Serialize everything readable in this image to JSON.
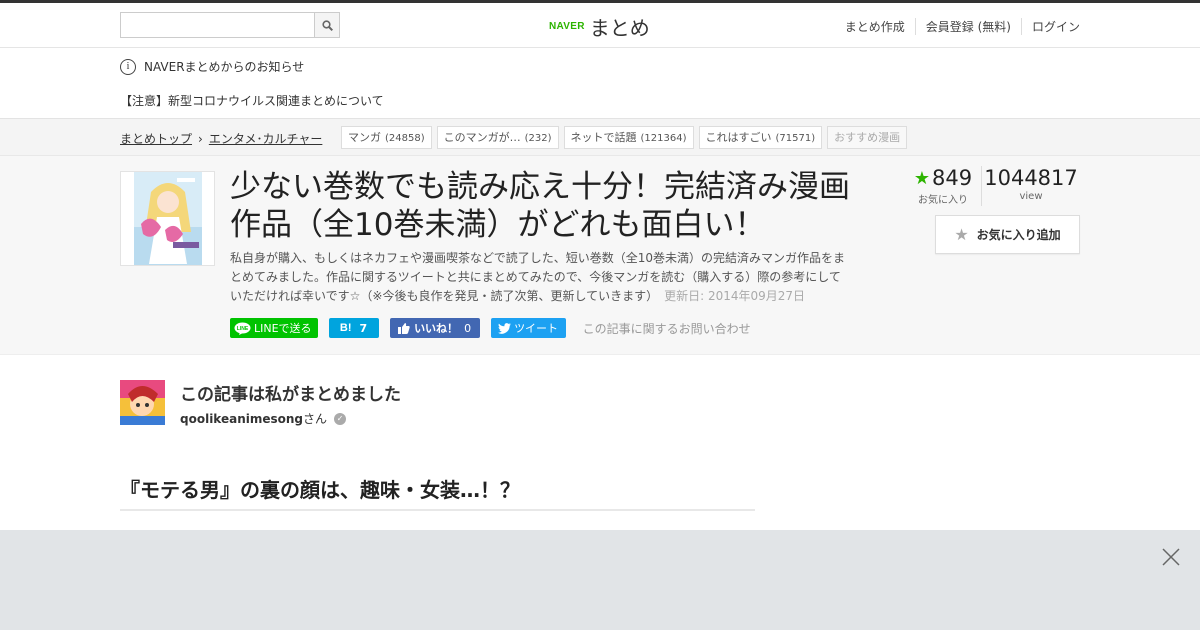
{
  "header": {
    "search_placeholder": "",
    "logo_brand": "NAVER",
    "logo_text": "まとめ",
    "nav": [
      "まとめ作成",
      "会員登録 (無料)",
      "ログイン"
    ]
  },
  "notice": {
    "title": "NAVERまとめからのお知らせ",
    "message": "【注意】新型コロナウイルス関連まとめについて"
  },
  "breadcrumb": {
    "home": "まとめトップ",
    "category": "エンタメ･カルチャー"
  },
  "tags": [
    {
      "label": "マンガ",
      "count": "(24858)"
    },
    {
      "label": "このマンガが…",
      "count": "(232)"
    },
    {
      "label": "ネットで話題",
      "count": "(121364)"
    },
    {
      "label": "これはすごい",
      "count": "(71571)"
    },
    {
      "label": "おすすめ漫画",
      "count": ""
    }
  ],
  "article": {
    "title": "少ない巻数でも読み応え十分！完結済み漫画作品（全10巻未満）がどれも面白い！",
    "description": "私自身が購入、もしくはネカフェや漫画喫茶などで読了した、短い巻数（全10巻未満）の完結済みマンガ作品をまとめてみました。作品に関するツイートと共にまとめてみたので、今後マンガを読む（購入する）際の参考にしていただければ幸いです☆（※今後も良作を発見・読了次第、更新していきます）",
    "updated": "更新日: 2014年09月27日",
    "favorites": "849",
    "favorites_label": "お気に入り",
    "views": "1044817",
    "views_label": "view",
    "fav_button": "お気に入り追加"
  },
  "share": {
    "line": "LINEで送る",
    "hatena_count": "7",
    "fb_label": "いいね！",
    "fb_count": "0",
    "tweet": "ツイート",
    "contact": "この記事に関するお問い合わせ"
  },
  "author": {
    "heading": "この記事は私がまとめました",
    "name": "qoolikeanimesong",
    "suffix": "さん"
  },
  "section": {
    "heading": "『モテる男』の裏の顔は、趣味・女装…！？"
  },
  "colors": {
    "brand_green": "#2db400",
    "line_green": "#00c300",
    "hatena_blue": "#00a4de",
    "facebook_blue": "#4267b2",
    "twitter_blue": "#1da1f2"
  }
}
